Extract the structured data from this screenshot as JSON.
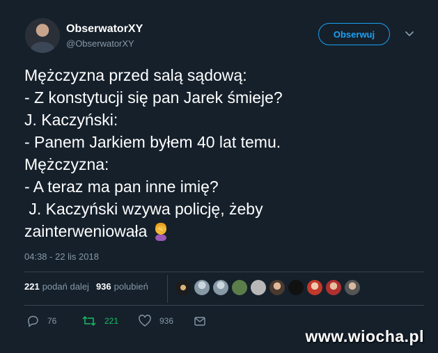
{
  "author": {
    "name": "ObserwatorXY",
    "handle": "@ObserwatorXY"
  },
  "follow_label": "Obserwuj",
  "tweet_lines": [
    "Mężczyzna przed salą sądową:",
    "- Z konstytucji się pan Jarek śmieje?",
    "J. Kaczyński:",
    "- Panem Jarkiem byłem 40 lat temu.",
    "Mężczyzna:",
    "- A teraz ma pan inne imię?",
    " J. Kaczyński wzywa policję, żeby",
    "zainterweniowała"
  ],
  "timestamp": "04:38 - 22 lis 2018",
  "stats": {
    "retweets_count": "221",
    "retweets_label": "podań dalej",
    "likes_count": "936",
    "likes_label": "polubień"
  },
  "actions": {
    "replies": "76",
    "retweets": "221",
    "likes": "936"
  },
  "colors": {
    "background": "#15202b",
    "accent": "#1da1f2",
    "retweet": "#17bf63",
    "muted": "#8899a6"
  },
  "icons": [
    "chevron-down-icon",
    "facepalm-emoji-icon",
    "reply-icon",
    "retweet-icon",
    "heart-icon",
    "message-icon"
  ],
  "watermark": "www.wiocha.pl"
}
